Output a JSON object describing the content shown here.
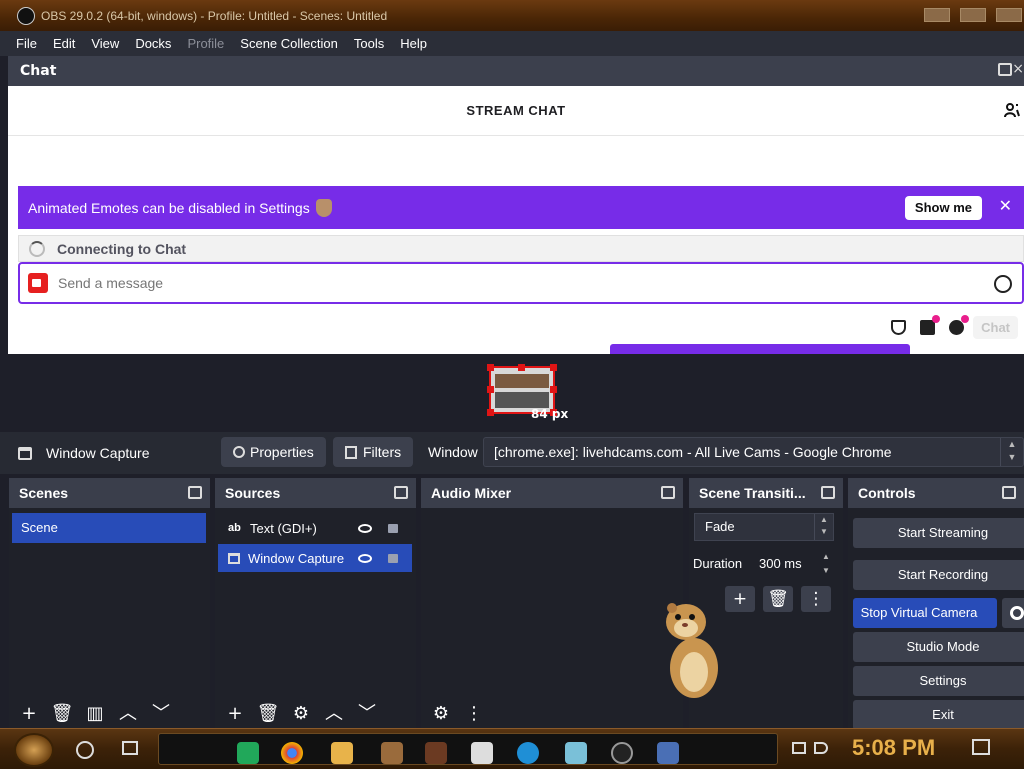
{
  "window": {
    "title": "OBS 29.0.2 (64-bit, windows) - Profile: Untitled - Scenes: Untitled"
  },
  "menu": [
    {
      "label": "File",
      "disabled": false
    },
    {
      "label": "Edit",
      "disabled": false
    },
    {
      "label": "View",
      "disabled": false
    },
    {
      "label": "Docks",
      "disabled": false
    },
    {
      "label": "Profile",
      "disabled": true
    },
    {
      "label": "Scene Collection",
      "disabled": false
    },
    {
      "label": "Tools",
      "disabled": false
    },
    {
      "label": "Help",
      "disabled": false
    }
  ],
  "chat_dock": {
    "title": "Chat",
    "header": "STREAM CHAT",
    "banner_text": "Animated Emotes can be disabled in Settings",
    "banner_button": "Show me",
    "connecting": "Connecting to Chat",
    "input_placeholder": "Send a message",
    "chat_button": "Chat"
  },
  "preview": {
    "size_label": "84 px"
  },
  "source_toolbar": {
    "source_name": "Window Capture",
    "properties_label": "Properties",
    "filters_label": "Filters",
    "window_label": "Window",
    "window_value": "[chrome.exe]: livehdcams.com - All Live Cams - Google Chrome"
  },
  "scenes": {
    "title": "Scenes",
    "items": [
      "Scene"
    ]
  },
  "sources": {
    "title": "Sources",
    "items": [
      {
        "label": "Text (GDI+)",
        "icon": "text-icon"
      },
      {
        "label": "Window Capture",
        "icon": "window-icon"
      }
    ]
  },
  "mixer": {
    "title": "Audio Mixer"
  },
  "transitions": {
    "title": "Scene Transiti...",
    "selected": "Fade",
    "duration_label": "Duration",
    "duration_value": "300 ms"
  },
  "controls": {
    "title": "Controls",
    "start_streaming": "Start Streaming",
    "start_recording": "Start Recording",
    "stop_virtual_camera": "Stop Virtual Camera",
    "studio_mode": "Studio Mode",
    "settings": "Settings",
    "exit": "Exit"
  },
  "taskbar": {
    "clock": "5:08 PM"
  },
  "colors": {
    "accent_blue": "#284cb8",
    "twitch_purple": "#772ce8",
    "recording_red": "#e01515"
  }
}
